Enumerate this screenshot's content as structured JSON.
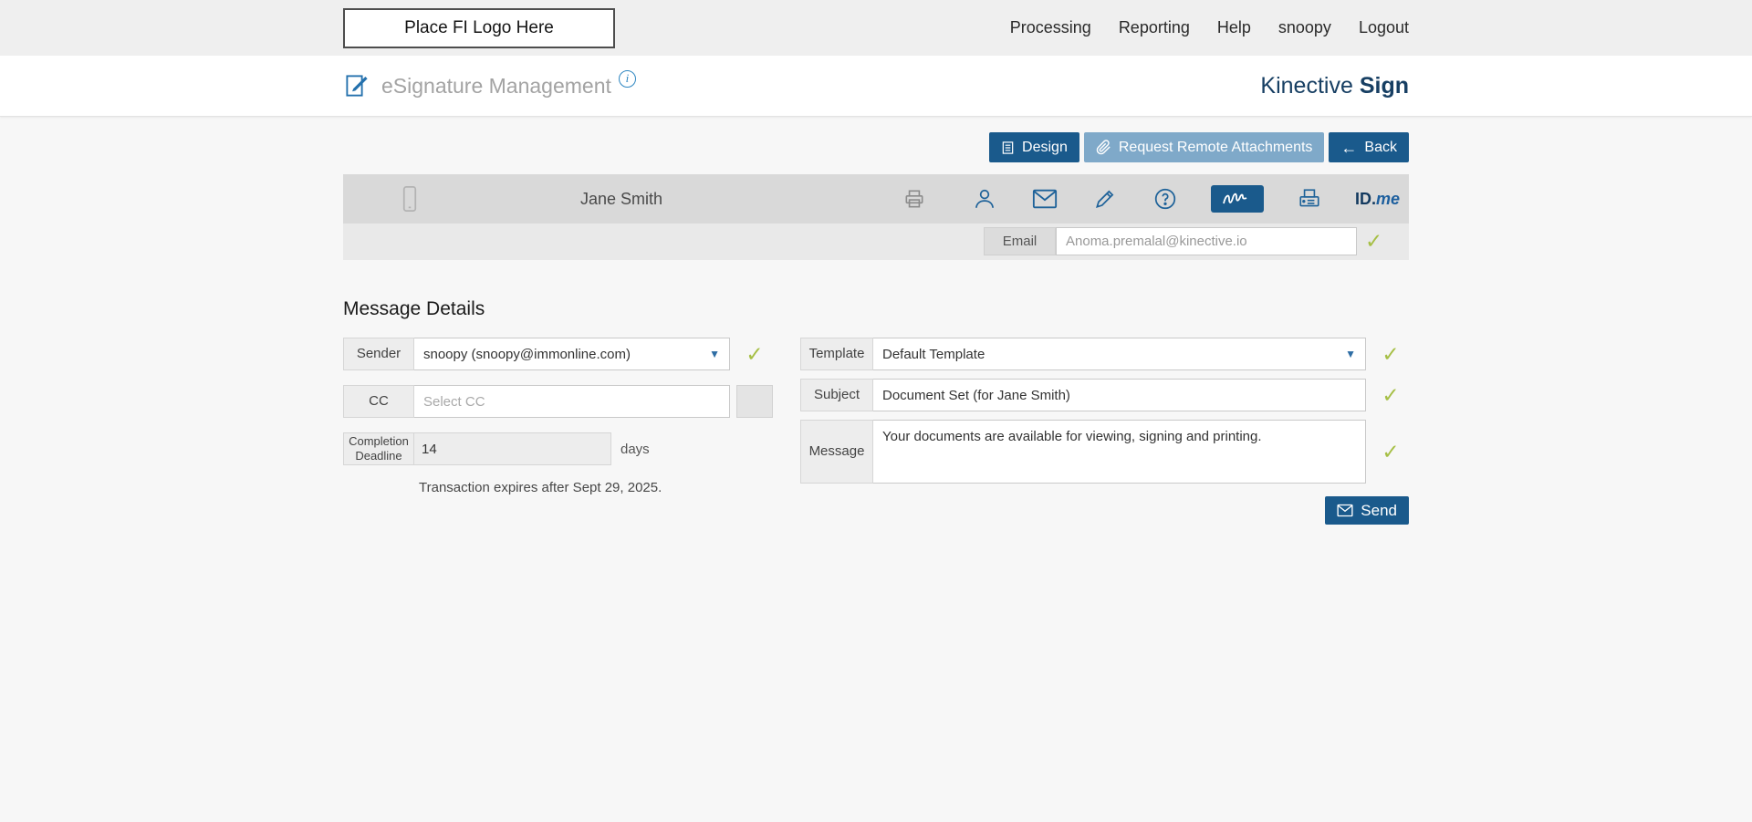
{
  "topbar": {
    "logo_placeholder": "Place FI Logo Here",
    "nav": [
      {
        "label": "Processing"
      },
      {
        "label": "Reporting"
      },
      {
        "label": "Help"
      },
      {
        "label": "snoopy"
      },
      {
        "label": "Logout"
      }
    ]
  },
  "header": {
    "title": "eSignature Management",
    "info_glyph": "i",
    "brand_name": "Kinective",
    "brand_product": "Sign"
  },
  "toolbar": {
    "design": "Design",
    "request_remote_attachments": "Request Remote Attachments",
    "back": "Back",
    "back_arrow": "←"
  },
  "recipient": {
    "name": "Jane Smith",
    "email_label": "Email",
    "email_value": "Anoma.premalal@kinective.io",
    "idme_id": "ID.",
    "idme_me": "me",
    "icons": [
      "mobile-icon",
      "printer-icon",
      "person-icon",
      "email-envelope-icon",
      "esign-pen-icon",
      "kba-question-icon",
      "remote-signature-icon",
      "fax-icon",
      "idme-logo"
    ]
  },
  "form": {
    "heading": "Message Details",
    "sender_label": "Sender",
    "sender_value": "snoopy (snoopy@immonline.com)",
    "cc_label": "CC",
    "cc_placeholder": "Select CC",
    "deadline_label": "Completion Deadline",
    "deadline_value": "14",
    "deadline_unit": "days",
    "expiry_note": "Transaction expires after Sept 29, 2025.",
    "template_label": "Template",
    "template_value": "Default Template",
    "subject_label": "Subject",
    "subject_value": "Document Set (for Jane Smith)",
    "message_label": "Message",
    "message_value": "Your documents are available for viewing, signing and printing.",
    "send": "Send"
  },
  "glyphs": {
    "check": "✓",
    "dropdown_arrow": "▼"
  },
  "colors": {
    "primary_blue": "#1a5a8c",
    "light_blue_button": "#7fa9c9",
    "check_green": "#a6bf45",
    "bar_gray": "#d9d9d9",
    "page_bg": "#f7f7f7"
  }
}
